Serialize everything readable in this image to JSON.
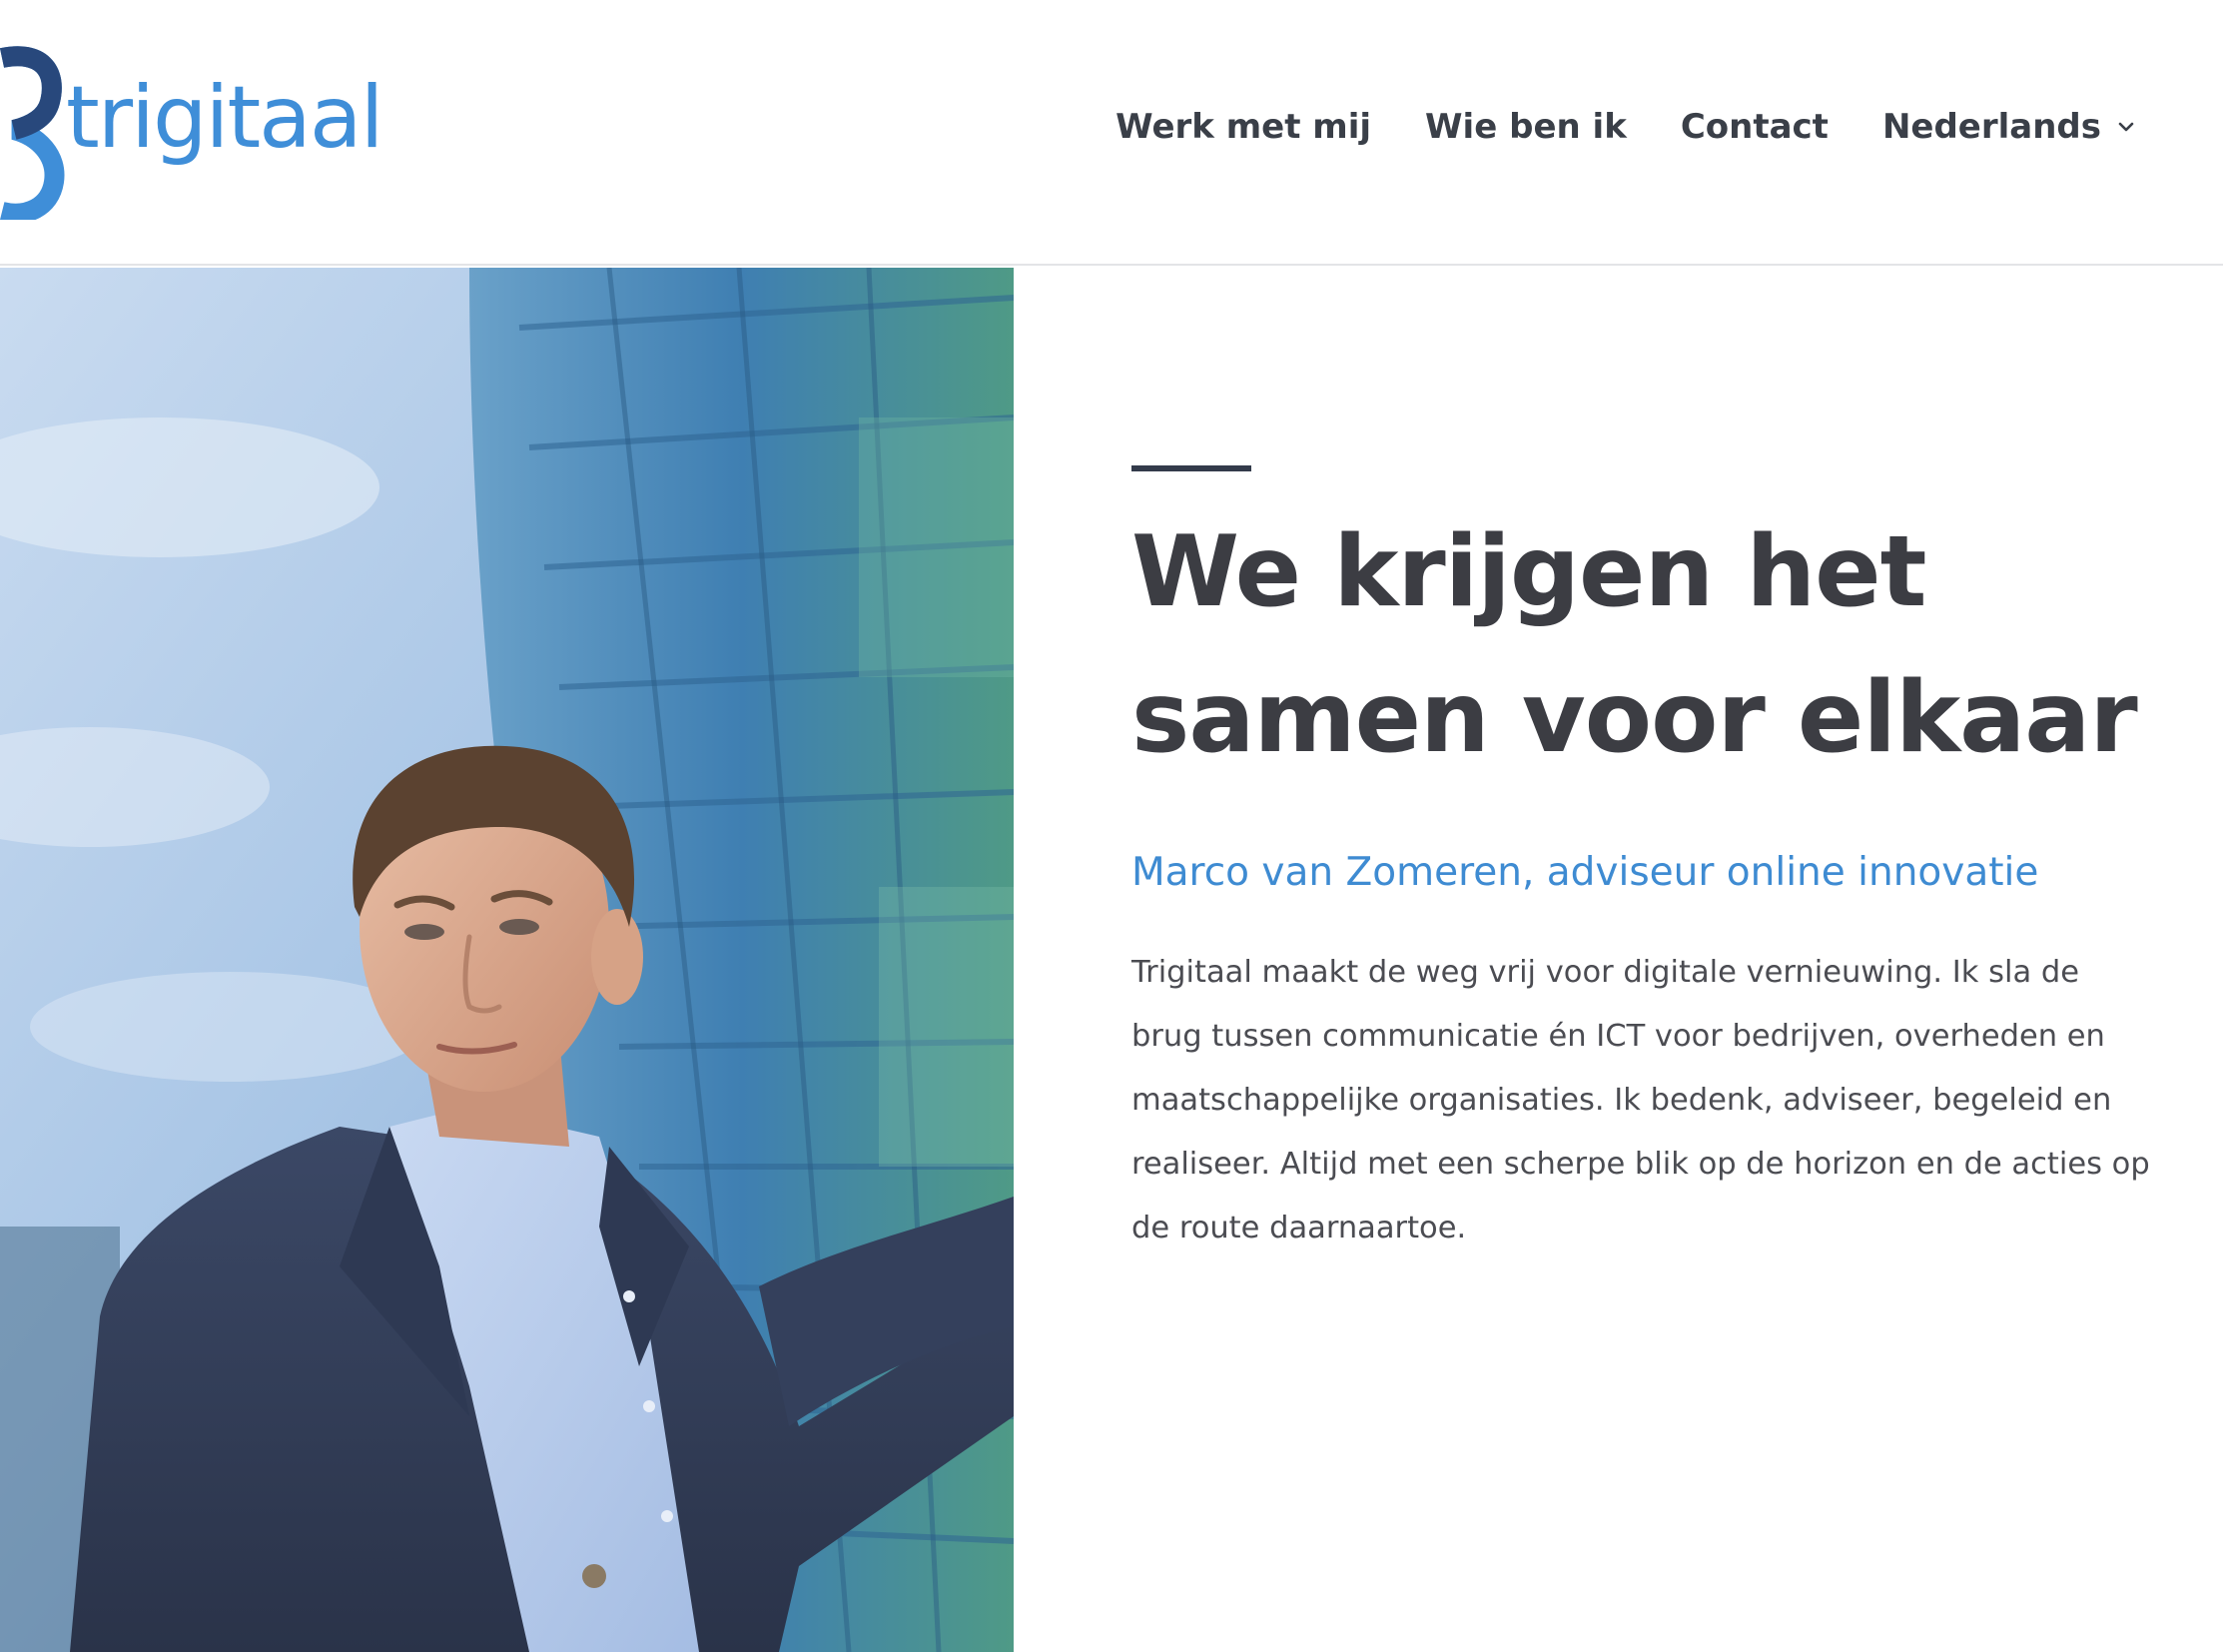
{
  "header": {
    "logo_text": "trigitaal",
    "brand_color": "#3f8ed8",
    "nav": {
      "items": [
        {
          "label": "Werk met mij"
        },
        {
          "label": "Wie ben ik"
        },
        {
          "label": "Contact"
        },
        {
          "label": "Nederlands",
          "has_dropdown": true
        }
      ]
    }
  },
  "hero": {
    "headline_line1": "We krijgen het",
    "headline_line2": "samen voor elkaar",
    "subtitle": "Marco van Zomeren, adviseur online innovatie",
    "body": "Trigitaal maakt de weg vrij voor digitale vernieuwing. Ik sla de brug tussen communicatie én ICT voor bedrijven, overheden en maatschappelijke organisaties. Ik bedenk, adviseer, begeleid en realiseer. Altijd met een scherpe blik op de horizon en de acties op de route daarnaartoe.",
    "accent_color": "#333b4b",
    "headline_color": "#3c3d43",
    "subtitle_color": "#3e8bd2"
  }
}
